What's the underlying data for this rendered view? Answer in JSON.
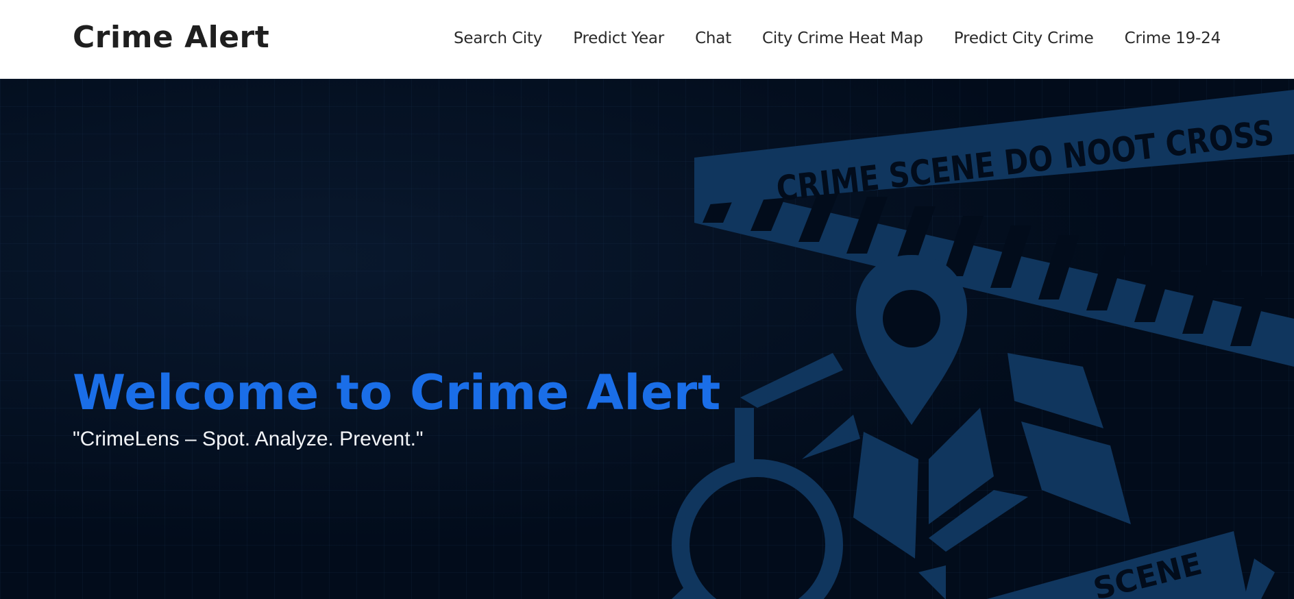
{
  "navbar": {
    "brand": "Crime Alert",
    "links": [
      {
        "label": "Search City"
      },
      {
        "label": "Predict Year"
      },
      {
        "label": "Chat"
      },
      {
        "label": "City Crime Heat Map"
      },
      {
        "label": "Predict City Crime"
      },
      {
        "label": "Crime 19-24"
      }
    ]
  },
  "hero": {
    "title": "Welcome to Crime Alert",
    "subtitle": "\"CrimeLens – Spot. Analyze. Prevent.\"",
    "tape_text_top": "CRIME SCENE DO NOOT CROSS",
    "tape_text_bottom": "SCENE",
    "icons": [
      "crime-scene-tape",
      "location-pin-icon",
      "folded-map-icon",
      "magnifying-glass-icon"
    ]
  },
  "colors": {
    "hero_background": "#020c1b",
    "accent": "#1a6ee8",
    "illustration": "#10365e",
    "nav_text": "#2a2a2a"
  }
}
